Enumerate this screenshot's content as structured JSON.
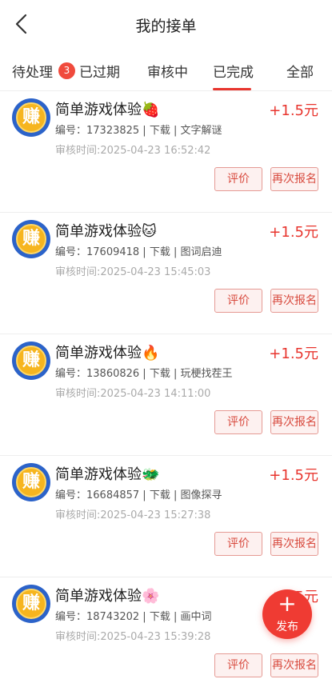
{
  "header": {
    "title": "我的接单"
  },
  "tabs": [
    {
      "label": "待处理",
      "badge": "3"
    },
    {
      "label": "已过期"
    },
    {
      "label": "审核中"
    },
    {
      "label": "已完成",
      "active": true
    },
    {
      "label": "全部"
    }
  ],
  "accent_color": "#e8352e",
  "orders": [
    {
      "logo": "赚",
      "title": "简单游戏体验🍓",
      "meta": "编号：17323825 | 下载 | 文字解谜",
      "time": "审核时间:2025-04-23 16:52:42",
      "reward": "+1.5元",
      "rate_label": "评价",
      "again_label": "再次报名"
    },
    {
      "logo": "赚",
      "title": "简单游戏体验🐱",
      "meta": "编号：17609418 | 下载 | 图词启迪",
      "time": "审核时间:2025-04-23 15:45:03",
      "reward": "+1.5元",
      "rate_label": "评价",
      "again_label": "再次报名"
    },
    {
      "logo": "赚",
      "title": "简单游戏体验🔥",
      "meta": "编号：13860826 | 下载 | 玩梗找茬王",
      "time": "审核时间:2025-04-23 14:11:00",
      "reward": "+1.5元",
      "rate_label": "评价",
      "again_label": "再次报名"
    },
    {
      "logo": "赚",
      "title": "简单游戏体验🐲",
      "meta": "编号：16684857 | 下载 | 图像探寻",
      "time": "审核时间:2025-04-23 15:27:38",
      "reward": "+1.5元",
      "rate_label": "评价",
      "again_label": "再次报名"
    },
    {
      "logo": "赚",
      "title": "简单游戏体验🌸",
      "meta": "编号：18743202 | 下载 | 画中词",
      "time": "审核时间:2025-04-23 15:39:28",
      "reward": "+1.5元",
      "rate_label": "评价",
      "again_label": "再次报名"
    }
  ],
  "fab": {
    "icon": "plus-icon",
    "plus": "+",
    "label": "发布"
  }
}
